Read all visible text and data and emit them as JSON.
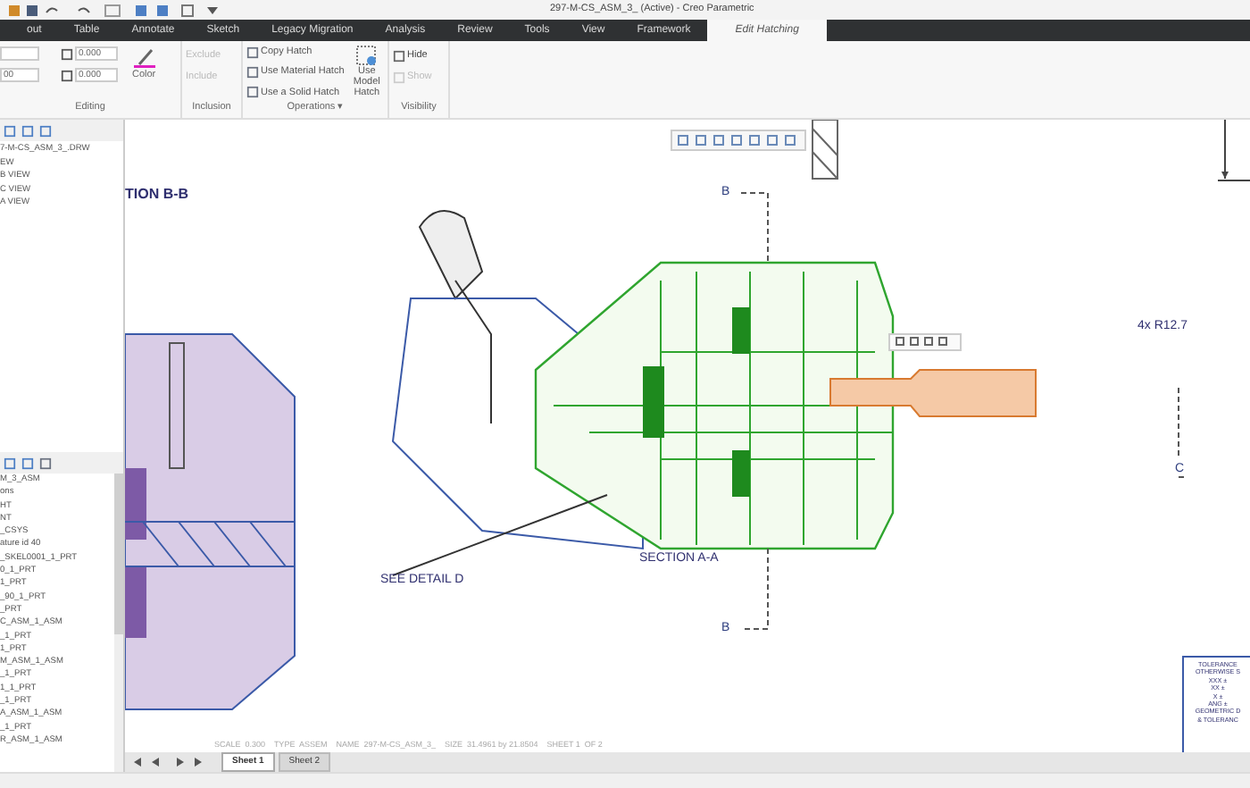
{
  "window": {
    "title": "297-M-CS_ASM_3_ (Active) - Creo Parametric"
  },
  "ribbon_tabs": [
    {
      "label": "out",
      "selected": false
    },
    {
      "label": "Table",
      "selected": false
    },
    {
      "label": "Annotate",
      "selected": false
    },
    {
      "label": "Sketch",
      "selected": false
    },
    {
      "label": "Legacy Migration",
      "selected": false
    },
    {
      "label": "Analysis",
      "selected": false
    },
    {
      "label": "Review",
      "selected": false
    },
    {
      "label": "Tools",
      "selected": false
    },
    {
      "label": "View",
      "selected": false
    },
    {
      "label": "Framework",
      "selected": false
    },
    {
      "label": "Edit Hatching",
      "selected": true
    }
  ],
  "ribbon": {
    "editing": {
      "fields": [
        {
          "value": "0.000"
        },
        {
          "value": "0.000"
        }
      ],
      "cut_field": {
        "value": "00"
      },
      "color_label": "Color",
      "group": "Editing"
    },
    "inclusion": {
      "items": [
        {
          "label": "Exclude",
          "disabled": true
        },
        {
          "label": "Include",
          "disabled": true
        }
      ],
      "group": "Inclusion"
    },
    "operations": {
      "items": [
        {
          "label": "Copy Hatch"
        },
        {
          "label": "Use Material Hatch"
        },
        {
          "label": "Use a Solid Hatch"
        }
      ],
      "model_hatch": "Use Model Hatch",
      "group": "Operations ▾"
    },
    "visibility": {
      "items": [
        {
          "label": "Hide",
          "disabled": false
        },
        {
          "label": "Show",
          "disabled": true
        }
      ],
      "group": "Visibility"
    }
  },
  "drawing_tree": {
    "items": [
      "7-M-CS_ASM_3_.DRW",
      "EW",
      "B VIEW",
      "C VIEW",
      "A VIEW"
    ]
  },
  "model_tree": {
    "items": [
      "M_3_ASM",
      "ons",
      "HT",
      "NT",
      "_CSYS",
      "ature id 40",
      "_SKEL0001_1_PRT",
      "0_1_PRT",
      "1_PRT",
      "_90_1_PRT",
      "_PRT",
      "C_ASM_1_ASM",
      "_1_PRT",
      "1_PRT",
      "M_ASM_1_ASM",
      "_1_PRT",
      "1_1_PRT",
      "_1_PRT",
      "A_ASM_1_ASM",
      "_1_PRT",
      "R_ASM_1_ASM"
    ]
  },
  "drawing": {
    "view_title_left": "TION B-B",
    "cut_label_top": "B",
    "cut_label_bottom": "B",
    "detail_callout": "SEE DETAIL D",
    "view_title_center": "SECTION A-A",
    "radius_note": "4x R12.7",
    "cut_label_right": "C",
    "sheet_info": "SCALE  0.300    TYPE  ASSEM    NAME  297-M-CS_ASM_3_    SIZE  31.4961 by 21.8504    SHEET 1  OF 2",
    "title_block": [
      "TOLERANCE",
      "OTHERWISE S",
      "XXX ±",
      "XX ±",
      "X ±",
      "ANG ±",
      "GEOMETRIC D",
      "& TOLERANC"
    ]
  },
  "sheet_tabs": [
    {
      "label": "Sheet 1",
      "selected": true
    },
    {
      "label": "Sheet 2",
      "selected": false
    }
  ]
}
